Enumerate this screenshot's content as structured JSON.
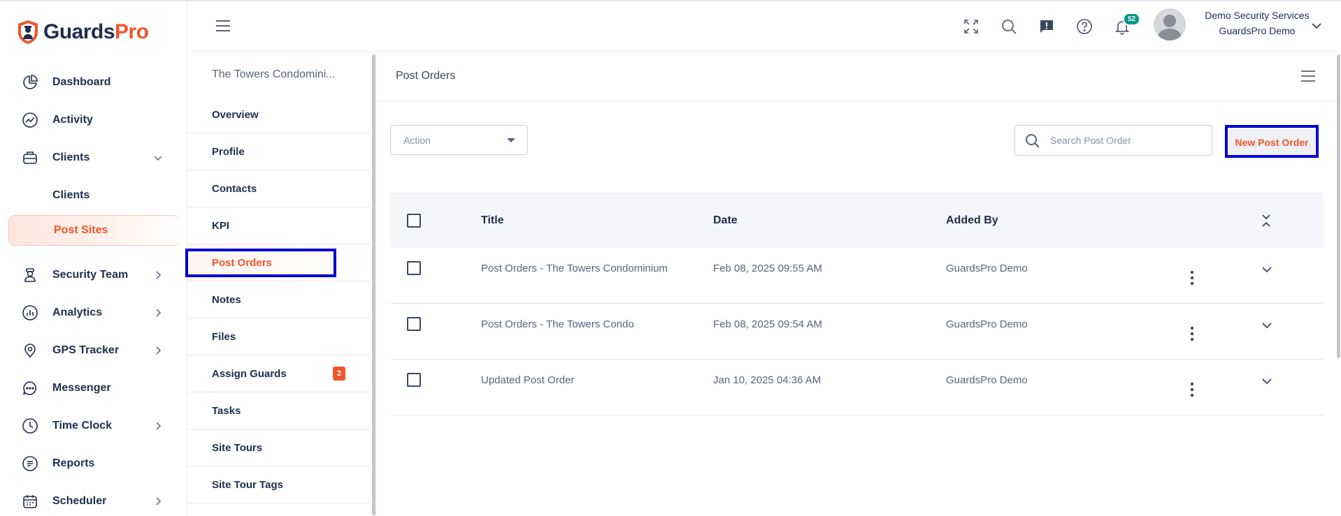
{
  "brand": {
    "name_part1": "Guards",
    "name_part2": "Pro",
    "colors": {
      "primary": "#f0542b",
      "navy": "#1f2d4e",
      "highlight": "#0000d6",
      "badge_teal": "#0b9488"
    }
  },
  "sidebar": {
    "items": [
      {
        "label": "Dashboard",
        "icon": "pie-chart-icon"
      },
      {
        "label": "Activity",
        "icon": "activity-chart-icon"
      },
      {
        "label": "Clients",
        "icon": "briefcase-icon",
        "expanded": true
      },
      {
        "label": "Clients",
        "sub": true
      },
      {
        "label": "Post Sites",
        "sub": true,
        "active": true
      },
      {
        "label": "Security Team",
        "icon": "guard-icon"
      },
      {
        "label": "Analytics",
        "icon": "analytics-icon"
      },
      {
        "label": "GPS Tracker",
        "icon": "location-pin-icon"
      },
      {
        "label": "Messenger",
        "icon": "chat-bubble-icon"
      },
      {
        "label": "Time Clock",
        "icon": "clock-icon"
      },
      {
        "label": "Reports",
        "icon": "report-icon"
      },
      {
        "label": "Scheduler",
        "icon": "calendar-icon"
      }
    ]
  },
  "header": {
    "notification_count": "52",
    "user": {
      "name": "Demo Security Services",
      "company": "GuardsPro Demo"
    }
  },
  "subnav": {
    "title": "The Towers Condomini...",
    "items": [
      {
        "label": "Overview"
      },
      {
        "label": "Profile"
      },
      {
        "label": "Contacts"
      },
      {
        "label": "KPI"
      },
      {
        "label": "Post Orders",
        "active": true
      },
      {
        "label": "Notes"
      },
      {
        "label": "Files"
      },
      {
        "label": "Assign Guards",
        "badge": "2"
      },
      {
        "label": "Tasks"
      },
      {
        "label": "Site Tours"
      },
      {
        "label": "Site Tour Tags"
      }
    ]
  },
  "main": {
    "title": "Post Orders",
    "action_label": "Action",
    "search_placeholder": "Search Post Order",
    "new_button": "New Post Order",
    "columns": {
      "title": "Title",
      "date": "Date",
      "added_by": "Added By"
    },
    "rows": [
      {
        "title": "Post Orders - The Towers Condominium",
        "date": "Feb 08, 2025 09:55 AM",
        "added_by": "GuardsPro Demo"
      },
      {
        "title": "Post Orders - The Towers Condo",
        "date": "Feb 08, 2025 09:54 AM",
        "added_by": "GuardsPro Demo"
      },
      {
        "title": "Updated Post Order",
        "date": "Jan 10, 2025 04:36 AM",
        "added_by": "GuardsPro Demo"
      }
    ]
  }
}
